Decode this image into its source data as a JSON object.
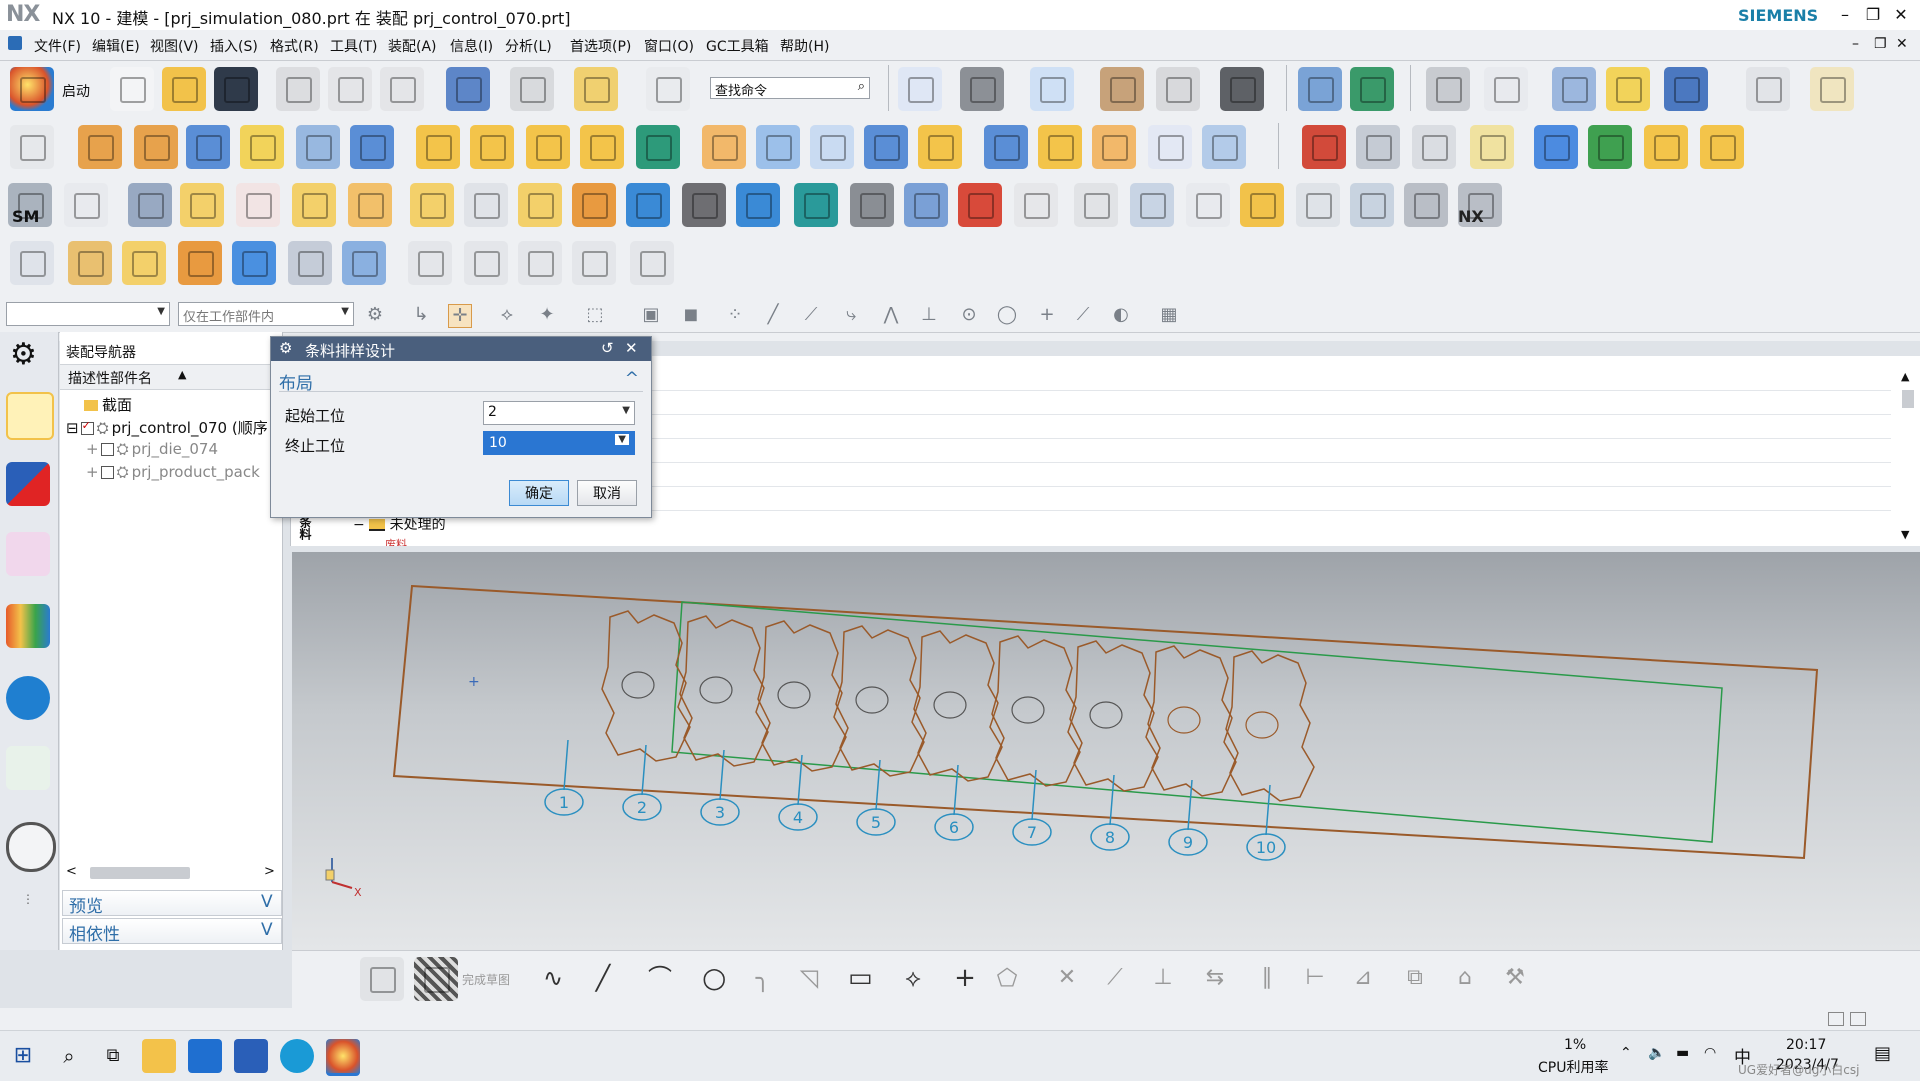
{
  "titlebar": {
    "logo": "NX",
    "title": "NX 10 - 建模 - [prj_simulation_080.prt 在 装配 prj_control_070.prt]",
    "brand": "SIEMENS",
    "min": "–",
    "restore": "❐",
    "close": "✕"
  },
  "menubar": {
    "items": [
      "文件(F)",
      "编辑(E)",
      "视图(V)",
      "插入(S)",
      "格式(R)",
      "工具(T)",
      "装配(A)",
      "信息(I)",
      "分析(L)",
      "首选项(P)",
      "窗口(O)",
      "GC工具箱",
      "帮助(H)"
    ],
    "win_min": "–",
    "win_restore": "❐",
    "win_close": "✕"
  },
  "ribbon": {
    "start_label": "启动",
    "search_placeholder": "查找命令",
    "row4_label_nx": "NX",
    "row3_label_sm": "SM"
  },
  "filterbar": {
    "filter_value": "",
    "scope_value": "仅在工作部件内"
  },
  "navigator": {
    "title": "装配导航器",
    "column": "描述性部件名",
    "sort_glyph": "▲",
    "rows": [
      {
        "label": "截面",
        "checked": false,
        "gray": false
      },
      {
        "label": "prj_control_070 (顺序",
        "checked": true,
        "gray": false
      },
      {
        "label": "prj_die_074",
        "checked": false,
        "gray": true
      },
      {
        "label": "prj_product_pack",
        "checked": false,
        "gray": true
      }
    ],
    "scroll_left": "<",
    "scroll_right": ">",
    "preview": "预览",
    "dependency": "相依性",
    "chevron": "V"
  },
  "dialog": {
    "title": "条料排样设计",
    "reset": "↺",
    "close": "✕",
    "section": "布局",
    "collapse": "^",
    "start_label": "起始工位",
    "start_value": "2",
    "end_label": "终止工位",
    "end_value": "10",
    "ok": "确定",
    "cancel": "取消"
  },
  "listpanel": {
    "side_tab": "条料",
    "unprocessed": "未处理的",
    "cut_fragment": "废料"
  },
  "graphics": {
    "station_numbers": [
      "1",
      "2",
      "3",
      "4",
      "5",
      "6",
      "7",
      "8",
      "9",
      "10"
    ],
    "axis_label": "X"
  },
  "bottombar": {
    "finish_sketch": "完成草图"
  },
  "taskbar": {
    "cpu_percent": "1%",
    "cpu_label": "CPU利用率",
    "ime": "中",
    "time": "20:17",
    "date": "2023/4/7",
    "watermark": "UG爱好者@ug小白csj"
  },
  "colors": {
    "strip_outline": "#9a5a2a",
    "station_circle": "#2a8fc0",
    "dialog_title_bg": "#4a5f7d",
    "accent": "#2f6ea8"
  }
}
